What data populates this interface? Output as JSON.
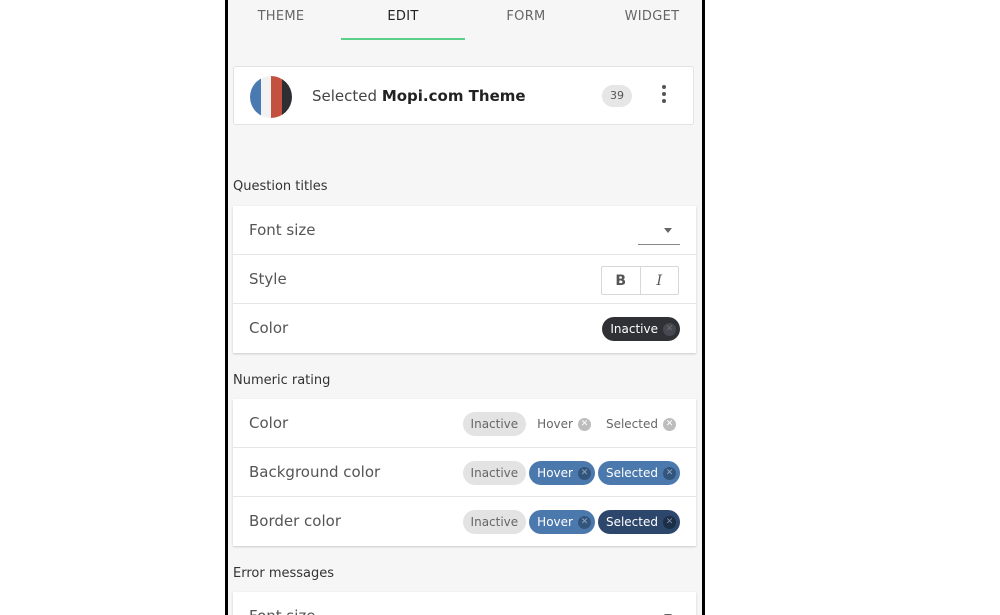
{
  "tabs": [
    {
      "label": "THEME"
    },
    {
      "label": "EDIT"
    },
    {
      "label": "FORM"
    },
    {
      "label": "WIDGET"
    }
  ],
  "active_tab": "EDIT",
  "theme_card": {
    "prefix": "Selected",
    "theme_name": "Mopi.com Theme",
    "count": "39",
    "flag_colors": [
      "#4a7ab2",
      "#f2f2f2",
      "#c4513f",
      "#2e2e33"
    ]
  },
  "sections": {
    "question_titles": {
      "title": "Question titles",
      "font_size_label": "Font size",
      "style_label": "Style",
      "style_bold": "B",
      "style_italic": "I",
      "color_label": "Color",
      "color_chip": "Inactive"
    },
    "numeric_rating": {
      "title": "Numeric rating",
      "rows": [
        {
          "label": "Color",
          "chips": [
            "Inactive",
            "Hover",
            "Selected"
          ]
        },
        {
          "label": "Background color",
          "chips": [
            "Inactive",
            "Hover",
            "Selected"
          ]
        },
        {
          "label": "Border color",
          "chips": [
            "Inactive",
            "Hover",
            "Selected"
          ]
        }
      ]
    },
    "error_messages": {
      "title": "Error messages",
      "font_size_label": "Font size"
    }
  },
  "icons": {
    "close_chip": "x-circle-icon",
    "kebab": "more-vertical-icon",
    "dropdown": "caret-down-icon"
  },
  "colors": {
    "tab_accent": "#5bd08a",
    "chip_hover": "#4b79ad",
    "chip_selected": "#2d466b",
    "chip_dark": "#2f3136"
  }
}
